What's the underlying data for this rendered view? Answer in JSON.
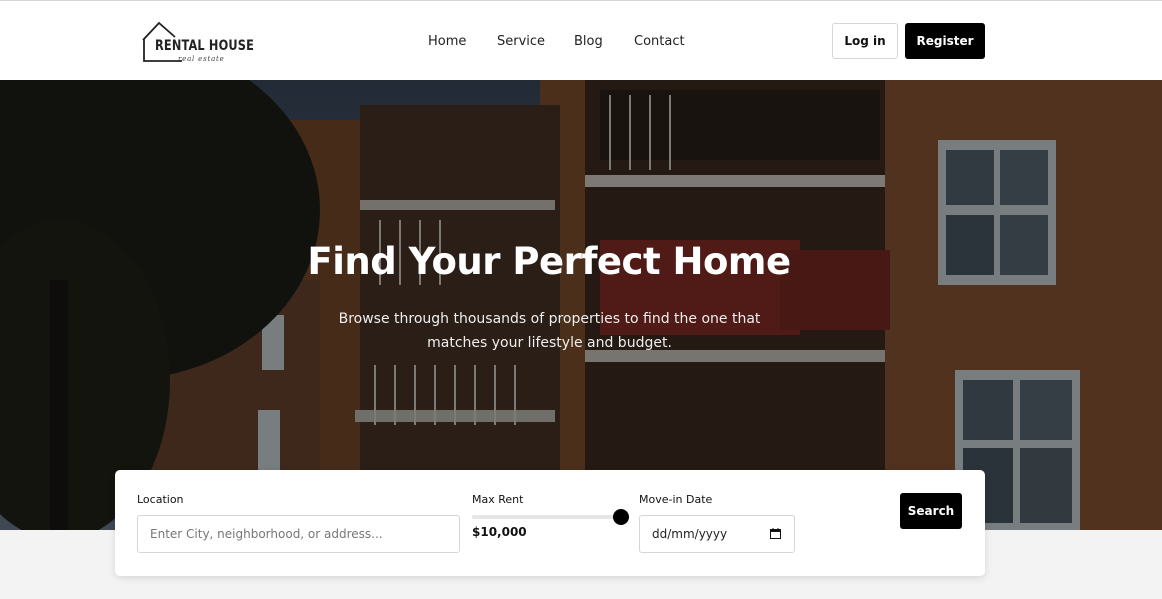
{
  "logo": {
    "main": "RENTAL HOUSE",
    "sub": "real estate"
  },
  "nav": {
    "home": "Home",
    "service": "Service",
    "blog": "Blog",
    "contact": "Contact"
  },
  "auth": {
    "login": "Log in",
    "register": "Register"
  },
  "hero": {
    "title": "Find Your Perfect Home",
    "subtitle": "Browse through thousands of properties to find the one that matches your lifestyle and budget."
  },
  "search": {
    "location_label": "Location",
    "location_placeholder": "Enter City, neighborhood, or address...",
    "rent_label": "Max Rent",
    "rent_value": "$10,000",
    "rent_slider_fraction": 1.0,
    "date_label": "Move-in Date",
    "date_placeholder": "dd/mm/yyyy",
    "button": "Search"
  },
  "colors": {
    "primary": "#000000",
    "background": "#f3f3f3",
    "text": "#222222"
  }
}
